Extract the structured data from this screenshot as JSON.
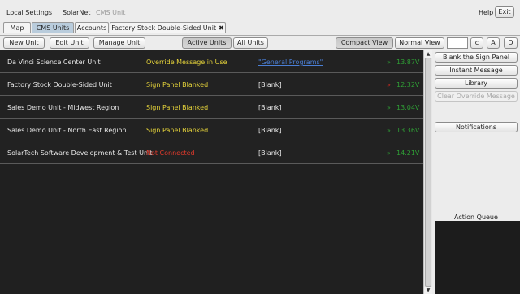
{
  "menu": {
    "local_settings": "Local Settings",
    "solarnet": "SolarNet",
    "cms_unit": "CMS Unit",
    "help": "Help",
    "exit": "Exit"
  },
  "tabs": [
    {
      "label": "Map"
    },
    {
      "label": "CMS Units"
    },
    {
      "label": "Accounts"
    },
    {
      "label": "Factory Stock Double-Sided Unit",
      "close": "✖"
    }
  ],
  "toolbar": {
    "new_unit": "New Unit",
    "edit_unit": "Edit Unit",
    "manage_unit": "Manage Unit",
    "active_units": "Active Units",
    "all_units": "All Units",
    "compact_view": "Compact View",
    "normal_view": "Normal View",
    "search_value": "",
    "c": "c",
    "a": "A",
    "d": "D"
  },
  "units": [
    {
      "name": "Da Vinci Science Center Unit",
      "status": "Override Message in Use",
      "status_color": "#e4d23a",
      "message": "\"General Programs\"",
      "message_is_link": true,
      "dot": "»",
      "voltage": "13.87V",
      "indicator_color": "#2f9e35"
    },
    {
      "name": "Factory Stock Double-Sided Unit",
      "status": "Sign Panel Blanked",
      "status_color": "#e4d23a",
      "message": "[Blank]",
      "message_is_link": false,
      "dot": "»",
      "voltage": "12.32V",
      "indicator_color": "#d62a20"
    },
    {
      "name": "Sales Demo Unit - Midwest Region",
      "status": "Sign Panel Blanked",
      "status_color": "#e4d23a",
      "message": "[Blank]",
      "message_is_link": false,
      "dot": "»",
      "voltage": "13.04V",
      "indicator_color": "#2f9e35"
    },
    {
      "name": "Sales Demo Unit - North East Region",
      "status": "Sign Panel Blanked",
      "status_color": "#e4d23a",
      "message": "[Blank]",
      "message_is_link": false,
      "dot": "»",
      "voltage": "13.36V",
      "indicator_color": "#2f9e35"
    },
    {
      "name": "SolarTech Software Development & Test Unit",
      "status": "Not Connected",
      "status_color": "#e23a2c",
      "message": "[Blank]",
      "message_is_link": false,
      "dot": "»",
      "voltage": "14.21V",
      "indicator_color": "#2f9e35"
    }
  ],
  "side": {
    "blank_sign_panel": "Blank the Sign Panel",
    "instant_message": "Instant Message",
    "library": "Library",
    "clear_override": "Clear Override Message",
    "notifications": "Notifications",
    "action_queue": "Action Queue"
  },
  "scroll": {
    "up": "▲",
    "down": "▼"
  }
}
